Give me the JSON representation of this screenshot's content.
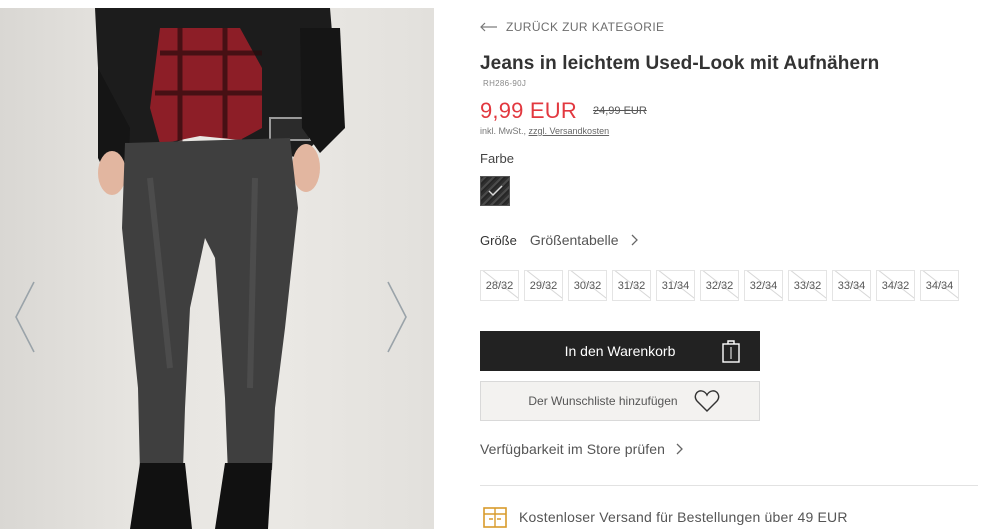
{
  "gallery": {
    "prev_icon": "chevron-left-icon",
    "next_icon": "chevron-right-icon"
  },
  "product": {
    "back_label": "ZURÜCK ZUR KATEGORIE",
    "title": "Jeans in leichtem Used-Look mit Aufnähern",
    "sku": "RH286-90J",
    "price_new": "9,99 EUR",
    "price_old": "24,99 EUR",
    "price_color": "#e2383f",
    "tax_text": "inkl. MwSt.,",
    "shipping_link": "zzgl. Versandkosten",
    "color_label": "Farbe",
    "size_label": "Größe",
    "size_guide_label": "Größentabelle",
    "sizes": [
      "28/32",
      "29/32",
      "30/32",
      "31/32",
      "31/34",
      "32/32",
      "32/34",
      "33/32",
      "33/34",
      "34/32",
      "34/34"
    ],
    "add_to_cart_label": "In den Warenkorb",
    "wishlist_label": "Der Wunschliste hinzufügen",
    "store_availability_label": "Verfügbarkeit im Store prüfen",
    "shipping_info": "Kostenloser Versand für Bestellungen über 49 EUR"
  }
}
